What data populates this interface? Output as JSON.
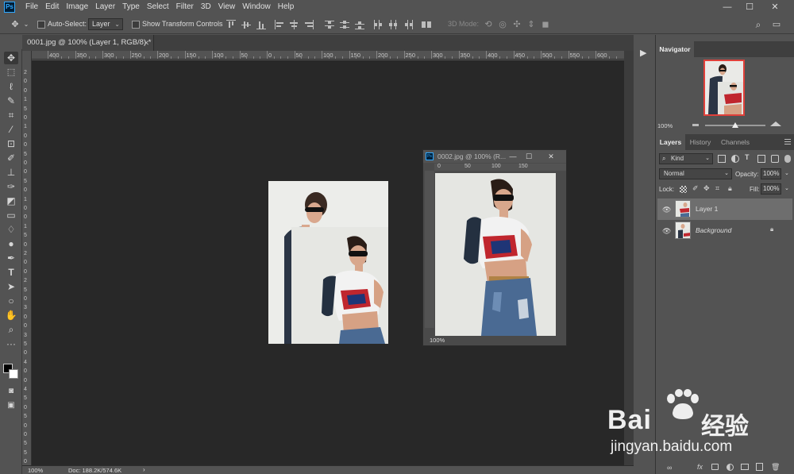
{
  "app": {
    "logo": "Ps"
  },
  "menu": [
    "File",
    "Edit",
    "Image",
    "Layer",
    "Type",
    "Select",
    "Filter",
    "3D",
    "View",
    "Window",
    "Help"
  ],
  "window_controls": {
    "minimize": "—",
    "maximize": "☐",
    "close": "✕"
  },
  "options": {
    "auto_select_label": "Auto-Select:",
    "auto_select_value": "Layer",
    "show_transform_label": "Show Transform Controls",
    "mode_3d_label": "3D Mode:"
  },
  "document": {
    "tab_title": "0001.jpg @ 100% (Layer 1, RGB/8) *",
    "zoom": "100%",
    "doc_info": "Doc: 188.2K/574.6K"
  },
  "ruler_top": [
    "400",
    "350",
    "300",
    "250",
    "200",
    "150",
    "100",
    "50",
    "0",
    "50",
    "100",
    "150",
    "200",
    "250",
    "300",
    "350",
    "400",
    "450",
    "500",
    "550",
    "600"
  ],
  "ruler_left": [
    "2",
    "0",
    "0",
    "1",
    "5",
    "0",
    "1",
    "0",
    "0",
    "5",
    "0",
    "0",
    "5",
    "0",
    "1",
    "0",
    "0",
    "1",
    "5",
    "0",
    "2",
    "0",
    "0",
    "2",
    "5",
    "0",
    "3",
    "0",
    "0",
    "3",
    "5",
    "0",
    "4",
    "0",
    "0",
    "4",
    "5",
    "0",
    "5",
    "0",
    "0",
    "5",
    "5",
    "0"
  ],
  "floating_window": {
    "title": "0002.jpg @ 100% (R...",
    "ruler_top": [
      "0",
      "50",
      "100",
      "150"
    ],
    "zoom": "100%"
  },
  "navigator": {
    "title": "Navigator",
    "zoom": "100%"
  },
  "layers_panel": {
    "tabs": [
      "Layers",
      "History",
      "Channels"
    ],
    "filter_label": "Kind",
    "blend_mode": "Normal",
    "opacity_label": "Opacity:",
    "opacity_value": "100%",
    "lock_label": "Lock:",
    "fill_label": "Fill:",
    "fill_value": "100%",
    "layers": [
      {
        "name": "Layer 1",
        "selected": true
      },
      {
        "name": "Background",
        "selected": false
      }
    ]
  },
  "watermark": {
    "line1": "Bai",
    "line1b": "经验",
    "line2": "jingyan.baidu.com"
  },
  "colors": {
    "bg": "#535353",
    "canvas": "#282828",
    "accent": "#31a8ff"
  }
}
